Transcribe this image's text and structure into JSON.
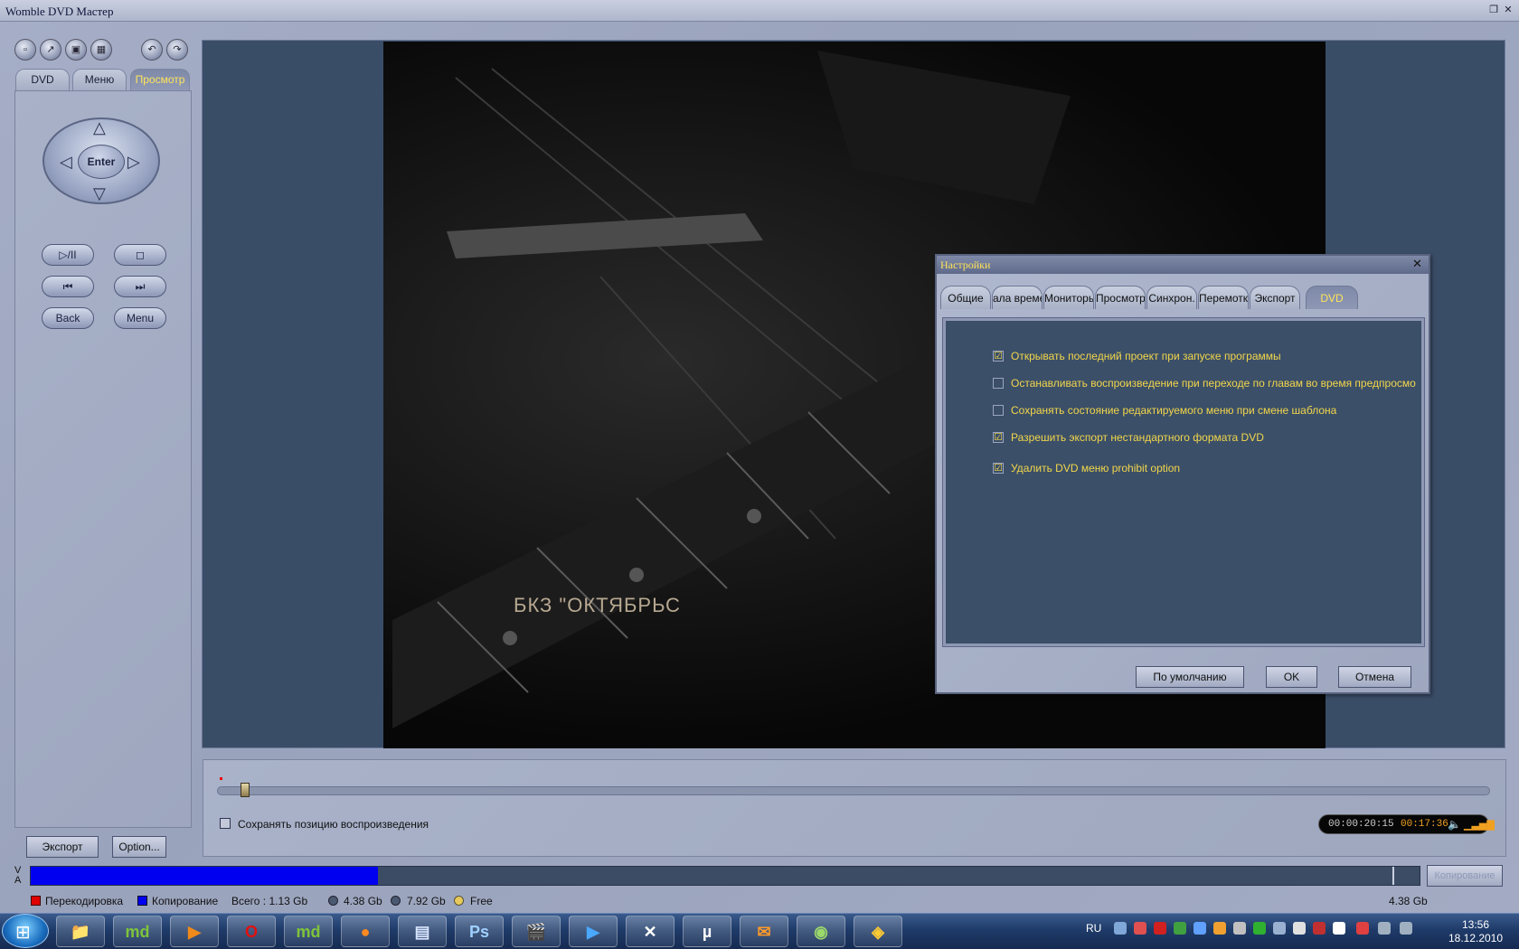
{
  "window": {
    "title": "Womble DVD Мастер"
  },
  "left": {
    "tabs": [
      {
        "label": "DVD"
      },
      {
        "label": "Меню"
      },
      {
        "label": "Просмотр"
      }
    ],
    "enter_label": "Enter",
    "transport": {
      "play_pause": "▷/II",
      "stop": "◻",
      "prev": "⏮",
      "next": "⏭",
      "back": "Back",
      "menu": "Menu"
    },
    "export_label": "Экспорт",
    "option_label": "Option..."
  },
  "video": {
    "overlay_text": "БКЗ \"ОКТЯБРЬС"
  },
  "timeline": {
    "keep_position_label": "Сохранять позицию воспроизведения",
    "time_current": "00:00:20:15",
    "time_total": "00:17:36"
  },
  "status": {
    "va_v": "V",
    "va_a": "A",
    "copy_button": "Копирование",
    "legend": [
      {
        "label": "Перекодировка",
        "color": "#e00000"
      },
      {
        "label": "Копирование",
        "color": "#0000f0"
      },
      {
        "label": "Всего : 1.13 Gb"
      },
      {
        "label": "4.38 Gb",
        "color": "#4a5870"
      },
      {
        "label": "7.92 Gb",
        "color": "#4a5870"
      },
      {
        "label": "Free",
        "color": "#e9c95c"
      }
    ],
    "right_size": "4.38 Gb",
    "used_fraction": 0.25
  },
  "dialog": {
    "title": "Настройки",
    "close": "✕",
    "tabs": [
      {
        "label": "Общие"
      },
      {
        "label": "ала време"
      },
      {
        "label": "Мониторы"
      },
      {
        "label": "Просмотр"
      },
      {
        "label": "Синхрон."
      },
      {
        "label": "Перемотка"
      },
      {
        "label": "Экспорт"
      },
      {
        "label": "DVD"
      }
    ],
    "options": [
      {
        "label": "Открывать последний проект при запуске программы",
        "checked": "☑"
      },
      {
        "label": "Останавливать воспроизведение при переходе по главам во время предпросмо",
        "checked": ""
      },
      {
        "label": "Сохранять состояние редактируемого меню при смене шаблона",
        "checked": ""
      },
      {
        "label": "Разрешить экспорт нестандартного формата DVD",
        "checked": "☑"
      },
      {
        "label": "Удалить DVD меню prohibit option",
        "checked": "☑"
      }
    ],
    "buttons": {
      "default": "По умолчанию",
      "ok": "OK",
      "cancel": "Отмена"
    }
  },
  "taskbar": {
    "apps": [
      {
        "name": "explorer",
        "glyph": "📁",
        "color": "#f0c85a"
      },
      {
        "name": "md",
        "glyph": "md",
        "color": "#7ec43a"
      },
      {
        "name": "media-player",
        "glyph": "▶",
        "color": "#f08a1a"
      },
      {
        "name": "opera",
        "glyph": "O",
        "color": "#e01010"
      },
      {
        "name": "md2",
        "glyph": "md",
        "color": "#7ec43a"
      },
      {
        "name": "firefox",
        "glyph": "●",
        "color": "#ff8a20"
      },
      {
        "name": "dvd-app",
        "glyph": "▤",
        "color": "#d8e6ff"
      },
      {
        "name": "photoshop",
        "glyph": "Ps",
        "color": "#9fd0ff"
      },
      {
        "name": "video-pro",
        "glyph": "🎬",
        "color": "#ffffff"
      },
      {
        "name": "media",
        "glyph": "▶",
        "color": "#4aa8ff"
      },
      {
        "name": "xnview",
        "glyph": "✕",
        "color": "#ffffff"
      },
      {
        "name": "utorrent",
        "glyph": "µ",
        "color": "#ffffff"
      },
      {
        "name": "mail",
        "glyph": "✉",
        "color": "#ff9a2a"
      },
      {
        "name": "network",
        "glyph": "◉",
        "color": "#9bd86a"
      },
      {
        "name": "womble",
        "glyph": "◈",
        "color": "#ffcc33"
      }
    ],
    "lang": "RU",
    "time": "13:56",
    "date": "18.12.2010"
  }
}
